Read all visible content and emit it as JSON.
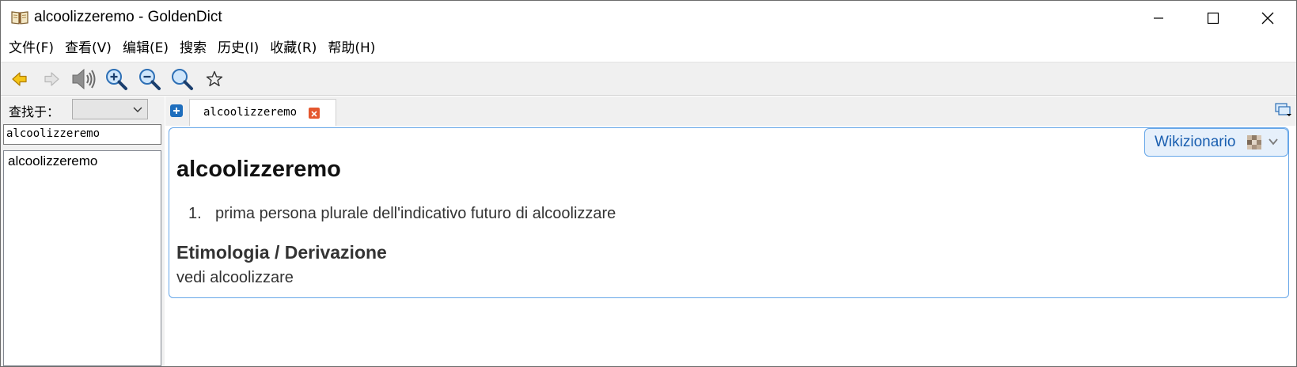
{
  "window": {
    "title": "alcoolizzeremo - GoldenDict"
  },
  "menu": {
    "items": [
      "文件(F)",
      "查看(V)",
      "编辑(E)",
      "搜索",
      "历史(I)",
      "收藏(R)",
      "帮助(H)"
    ]
  },
  "toolbar": {
    "icons": [
      "back-arrow-icon",
      "forward-arrow-icon",
      "speaker-icon",
      "zoom-in-icon",
      "zoom-out-icon",
      "zoom-reset-icon",
      "star-icon"
    ]
  },
  "left_panel": {
    "lookin_label": "查找于：",
    "lookin_value": "",
    "search_value": "alcoolizzeremo",
    "words": [
      "alcoolizzeremo"
    ]
  },
  "tabs": {
    "active_label": "alcoolizzeremo"
  },
  "article": {
    "dictionary_name": "Wikizionario",
    "headword": "alcoolizzeremo",
    "definitions": [
      {
        "num": "1.",
        "text": "prima persona plurale dell'indicativo futuro di alcoolizzare"
      }
    ],
    "section_title": "Etimologia / Derivazione",
    "section_text": "vedi alcoolizzare"
  },
  "colors": {
    "accent_border": "#66a6e8",
    "badge_bg": "#e6f0fb",
    "badge_text": "#1a5fb0",
    "tab_close": "#e4572e",
    "toolbar_bg": "#f0f0f0"
  }
}
